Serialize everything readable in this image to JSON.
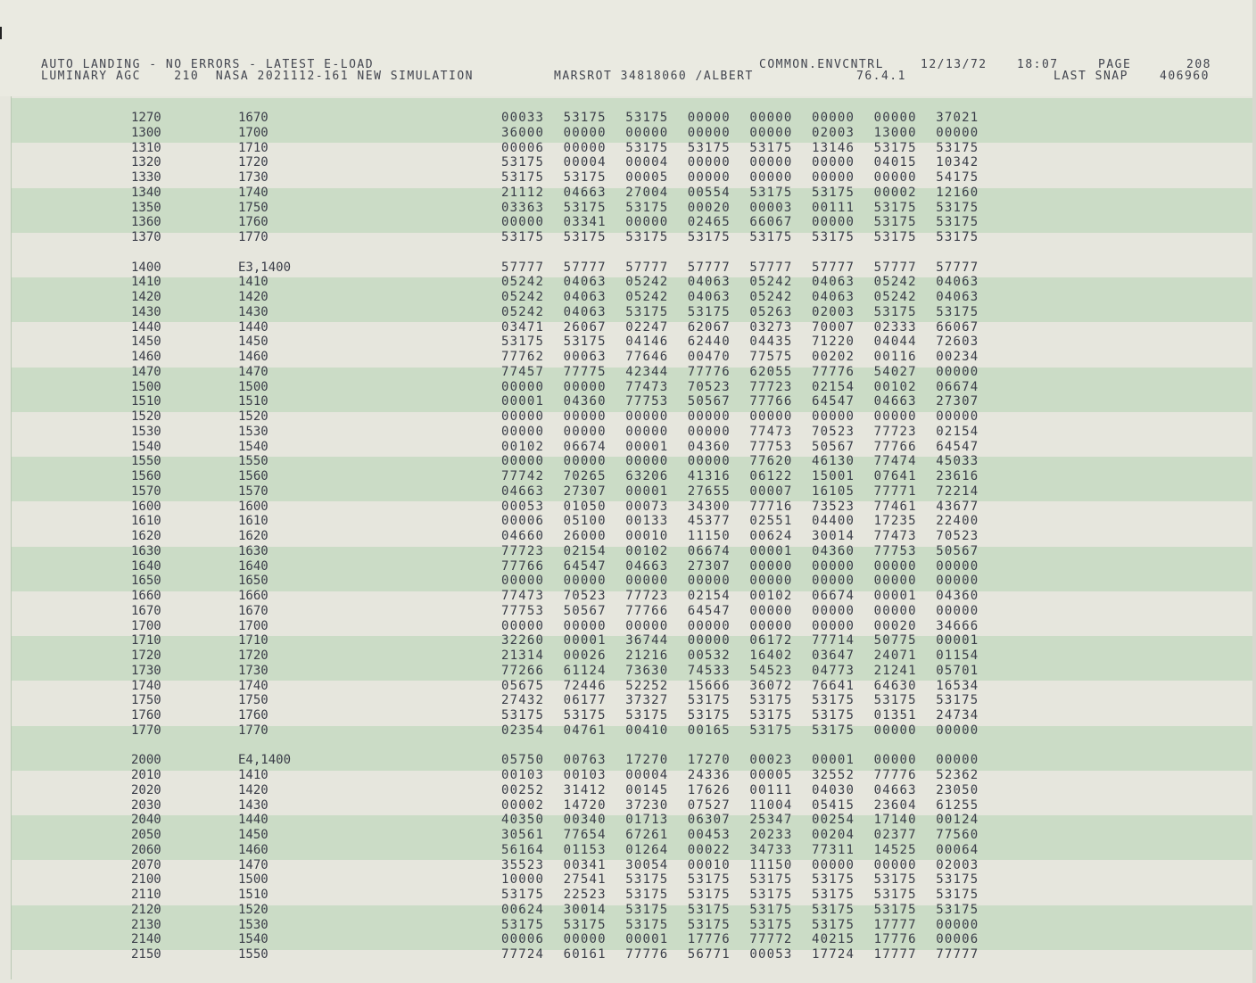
{
  "header": {
    "line1_left": "AUTO LANDING - NO ERRORS - LATEST E-LOAD",
    "line2_left": "LUMINARY AGC    210  NASA 2021112-161 NEW SIMULATION",
    "line2_mid": "MARSROT 34818060 /ALBERT",
    "line1_center": "COMMON.ENVCNTRL",
    "line2_center": "76.4.1",
    "date": "12/13/72",
    "time": "18:07",
    "page_label": "PAGE",
    "page_number": "208",
    "last_snap_label": "LAST SNAP",
    "last_snap_value": "406960"
  },
  "listing": [
    {
      "addr": "1270",
      "label": "1670",
      "words": [
        "00033",
        "53175",
        "53175",
        "00000",
        "00000",
        "00000",
        "00000",
        "37021"
      ]
    },
    {
      "addr": "1300",
      "label": "1700",
      "words": [
        "36000",
        "00000",
        "00000",
        "00000",
        "00000",
        "02003",
        "13000",
        "00000"
      ]
    },
    {
      "addr": "1310",
      "label": "1710",
      "words": [
        "00006",
        "00000",
        "53175",
        "53175",
        "53175",
        "13146",
        "53175",
        "53175"
      ]
    },
    {
      "addr": "1320",
      "label": "1720",
      "words": [
        "53175",
        "00004",
        "00004",
        "00000",
        "00000",
        "00000",
        "04015",
        "10342"
      ]
    },
    {
      "addr": "1330",
      "label": "1730",
      "words": [
        "53175",
        "53175",
        "00005",
        "00000",
        "00000",
        "00000",
        "00000",
        "54175"
      ]
    },
    {
      "addr": "1340",
      "label": "1740",
      "words": [
        "21112",
        "04663",
        "27004",
        "00554",
        "53175",
        "53175",
        "00002",
        "12160"
      ]
    },
    {
      "addr": "1350",
      "label": "1750",
      "words": [
        "03363",
        "53175",
        "53175",
        "00020",
        "00003",
        "00111",
        "53175",
        "53175"
      ]
    },
    {
      "addr": "1360",
      "label": "1760",
      "words": [
        "00000",
        "03341",
        "00000",
        "02465",
        "66067",
        "00000",
        "53175",
        "53175"
      ]
    },
    {
      "addr": "1370",
      "label": "1770",
      "words": [
        "53175",
        "53175",
        "53175",
        "53175",
        "53175",
        "53175",
        "53175",
        "53175"
      ]
    },
    {
      "addr": "",
      "label": "",
      "words": []
    },
    {
      "addr": "1400",
      "label": "E3,1400",
      "words": [
        "57777",
        "57777",
        "57777",
        "57777",
        "57777",
        "57777",
        "57777",
        "57777"
      ]
    },
    {
      "addr": "1410",
      "label": "1410",
      "words": [
        "05242",
        "04063",
        "05242",
        "04063",
        "05242",
        "04063",
        "05242",
        "04063"
      ]
    },
    {
      "addr": "1420",
      "label": "1420",
      "words": [
        "05242",
        "04063",
        "05242",
        "04063",
        "05242",
        "04063",
        "05242",
        "04063"
      ]
    },
    {
      "addr": "1430",
      "label": "1430",
      "words": [
        "05242",
        "04063",
        "53175",
        "53175",
        "05263",
        "02003",
        "53175",
        "53175"
      ]
    },
    {
      "addr": "1440",
      "label": "1440",
      "words": [
        "03471",
        "26067",
        "02247",
        "62067",
        "03273",
        "70007",
        "02333",
        "66067"
      ]
    },
    {
      "addr": "1450",
      "label": "1450",
      "words": [
        "53175",
        "53175",
        "04146",
        "62440",
        "04435",
        "71220",
        "04044",
        "72603"
      ]
    },
    {
      "addr": "1460",
      "label": "1460",
      "words": [
        "77762",
        "00063",
        "77646",
        "00470",
        "77575",
        "00202",
        "00116",
        "00234"
      ]
    },
    {
      "addr": "1470",
      "label": "1470",
      "words": [
        "77457",
        "77775",
        "42344",
        "77776",
        "62055",
        "77776",
        "54027",
        "00000"
      ]
    },
    {
      "addr": "1500",
      "label": "1500",
      "words": [
        "00000",
        "00000",
        "77473",
        "70523",
        "77723",
        "02154",
        "00102",
        "06674"
      ]
    },
    {
      "addr": "1510",
      "label": "1510",
      "words": [
        "00001",
        "04360",
        "77753",
        "50567",
        "77766",
        "64547",
        "04663",
        "27307"
      ]
    },
    {
      "addr": "1520",
      "label": "1520",
      "words": [
        "00000",
        "00000",
        "00000",
        "00000",
        "00000",
        "00000",
        "00000",
        "00000"
      ]
    },
    {
      "addr": "1530",
      "label": "1530",
      "words": [
        "00000",
        "00000",
        "00000",
        "00000",
        "77473",
        "70523",
        "77723",
        "02154"
      ]
    },
    {
      "addr": "1540",
      "label": "1540",
      "words": [
        "00102",
        "06674",
        "00001",
        "04360",
        "77753",
        "50567",
        "77766",
        "64547"
      ]
    },
    {
      "addr": "1550",
      "label": "1550",
      "words": [
        "00000",
        "00000",
        "00000",
        "00000",
        "77620",
        "46130",
        "77474",
        "45033"
      ]
    },
    {
      "addr": "1560",
      "label": "1560",
      "words": [
        "77742",
        "70265",
        "63206",
        "41316",
        "06122",
        "15001",
        "07641",
        "23616"
      ]
    },
    {
      "addr": "1570",
      "label": "1570",
      "words": [
        "04663",
        "27307",
        "00001",
        "27655",
        "00007",
        "16105",
        "77771",
        "72214"
      ]
    },
    {
      "addr": "1600",
      "label": "1600",
      "words": [
        "00053",
        "01050",
        "00073",
        "34300",
        "77716",
        "73523",
        "77461",
        "43677"
      ]
    },
    {
      "addr": "1610",
      "label": "1610",
      "words": [
        "00006",
        "05100",
        "00133",
        "45377",
        "02551",
        "04400",
        "17235",
        "22400"
      ]
    },
    {
      "addr": "1620",
      "label": "1620",
      "words": [
        "04660",
        "26000",
        "00010",
        "11150",
        "00624",
        "30014",
        "77473",
        "70523"
      ]
    },
    {
      "addr": "1630",
      "label": "1630",
      "words": [
        "77723",
        "02154",
        "00102",
        "06674",
        "00001",
        "04360",
        "77753",
        "50567"
      ]
    },
    {
      "addr": "1640",
      "label": "1640",
      "words": [
        "77766",
        "64547",
        "04663",
        "27307",
        "00000",
        "00000",
        "00000",
        "00000"
      ]
    },
    {
      "addr": "1650",
      "label": "1650",
      "words": [
        "00000",
        "00000",
        "00000",
        "00000",
        "00000",
        "00000",
        "00000",
        "00000"
      ]
    },
    {
      "addr": "1660",
      "label": "1660",
      "words": [
        "77473",
        "70523",
        "77723",
        "02154",
        "00102",
        "06674",
        "00001",
        "04360"
      ]
    },
    {
      "addr": "1670",
      "label": "1670",
      "words": [
        "77753",
        "50567",
        "77766",
        "64547",
        "00000",
        "00000",
        "00000",
        "00000"
      ]
    },
    {
      "addr": "1700",
      "label": "1700",
      "words": [
        "00000",
        "00000",
        "00000",
        "00000",
        "00000",
        "00000",
        "00020",
        "34666"
      ]
    },
    {
      "addr": "1710",
      "label": "1710",
      "words": [
        "32260",
        "00001",
        "36744",
        "00000",
        "06172",
        "77714",
        "50775",
        "00001"
      ]
    },
    {
      "addr": "1720",
      "label": "1720",
      "words": [
        "21314",
        "00026",
        "21216",
        "00532",
        "16402",
        "03647",
        "24071",
        "01154"
      ]
    },
    {
      "addr": "1730",
      "label": "1730",
      "words": [
        "77266",
        "61124",
        "73630",
        "74533",
        "54523",
        "04773",
        "21241",
        "05701"
      ]
    },
    {
      "addr": "1740",
      "label": "1740",
      "words": [
        "05675",
        "72446",
        "52252",
        "15666",
        "36072",
        "76641",
        "64630",
        "16534"
      ]
    },
    {
      "addr": "1750",
      "label": "1750",
      "words": [
        "27432",
        "06177",
        "37327",
        "53175",
        "53175",
        "53175",
        "53175",
        "53175"
      ]
    },
    {
      "addr": "1760",
      "label": "1760",
      "words": [
        "53175",
        "53175",
        "53175",
        "53175",
        "53175",
        "53175",
        "01351",
        "24734"
      ]
    },
    {
      "addr": "1770",
      "label": "1770",
      "words": [
        "02354",
        "04761",
        "00410",
        "00165",
        "53175",
        "53175",
        "00000",
        "00000"
      ]
    },
    {
      "addr": "",
      "label": "",
      "words": []
    },
    {
      "addr": "2000",
      "label": "E4,1400",
      "words": [
        "05750",
        "00763",
        "17270",
        "17270",
        "00023",
        "00001",
        "00000",
        "00000"
      ]
    },
    {
      "addr": "2010",
      "label": "1410",
      "words": [
        "00103",
        "00103",
        "00004",
        "24336",
        "00005",
        "32552",
        "77776",
        "52362"
      ]
    },
    {
      "addr": "2020",
      "label": "1420",
      "words": [
        "00252",
        "31412",
        "00145",
        "17626",
        "00111",
        "04030",
        "04663",
        "23050"
      ]
    },
    {
      "addr": "2030",
      "label": "1430",
      "words": [
        "00002",
        "14720",
        "37230",
        "07527",
        "11004",
        "05415",
        "23604",
        "61255"
      ]
    },
    {
      "addr": "2040",
      "label": "1440",
      "words": [
        "40350",
        "00340",
        "01713",
        "06307",
        "25347",
        "00254",
        "17140",
        "00124"
      ]
    },
    {
      "addr": "2050",
      "label": "1450",
      "words": [
        "30561",
        "77654",
        "67261",
        "00453",
        "20233",
        "00204",
        "02377",
        "77560"
      ]
    },
    {
      "addr": "2060",
      "label": "1460",
      "words": [
        "56164",
        "01153",
        "01264",
        "00022",
        "34733",
        "77311",
        "14525",
        "00064"
      ]
    },
    {
      "addr": "2070",
      "label": "1470",
      "words": [
        "35523",
        "00341",
        "30054",
        "00010",
        "11150",
        "00000",
        "00000",
        "02003"
      ]
    },
    {
      "addr": "2100",
      "label": "1500",
      "words": [
        "10000",
        "27541",
        "53175",
        "53175",
        "53175",
        "53175",
        "53175",
        "53175"
      ]
    },
    {
      "addr": "2110",
      "label": "1510",
      "words": [
        "53175",
        "22523",
        "53175",
        "53175",
        "53175",
        "53175",
        "53175",
        "53175"
      ]
    },
    {
      "addr": "2120",
      "label": "1520",
      "words": [
        "00624",
        "30014",
        "53175",
        "53175",
        "53175",
        "53175",
        "53175",
        "53175"
      ]
    },
    {
      "addr": "2130",
      "label": "1530",
      "words": [
        "53175",
        "53175",
        "53175",
        "53175",
        "53175",
        "53175",
        "17777",
        "00000"
      ]
    },
    {
      "addr": "2140",
      "label": "1540",
      "words": [
        "00006",
        "00000",
        "00001",
        "17776",
        "77772",
        "40215",
        "17776",
        "00006"
      ]
    },
    {
      "addr": "2150",
      "label": "1550",
      "words": [
        "77724",
        "60161",
        "77776",
        "56771",
        "00053",
        "17724",
        "17777",
        "77777"
      ]
    }
  ]
}
